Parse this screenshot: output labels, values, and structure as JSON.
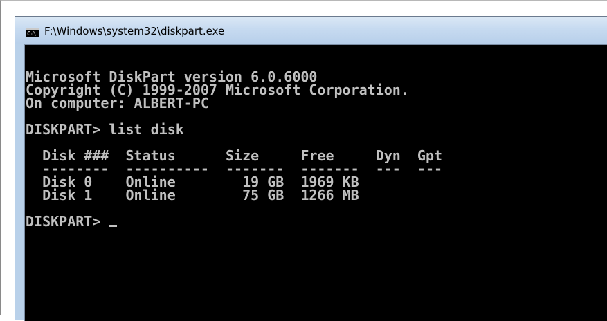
{
  "window": {
    "title": "F:\\Windows\\system32\\diskpart.exe",
    "icon_label": "C:\\",
    "icon": "console-app-icon"
  },
  "console": {
    "banner": [
      "Microsoft DiskPart version 6.0.6000",
      "Copyright (C) 1999-2007 Microsoft Corporation.",
      "On computer: ALBERT-PC"
    ],
    "command_line": "DISKPART> list disk",
    "table": {
      "header": "  Disk ###  Status      Size     Free     Dyn  Gpt",
      "separator": "  --------  ----------  -------  -------  ---  ---",
      "rows": [
        "  Disk 0    Online        19 GB  1969 KB",
        "  Disk 1    Online        75 GB  1266 MB"
      ]
    },
    "prompt": "DISKPART> "
  },
  "colors": {
    "console_background": "#000000",
    "console_text": "#c0c0c0",
    "titlebar": "#c6daf0"
  }
}
